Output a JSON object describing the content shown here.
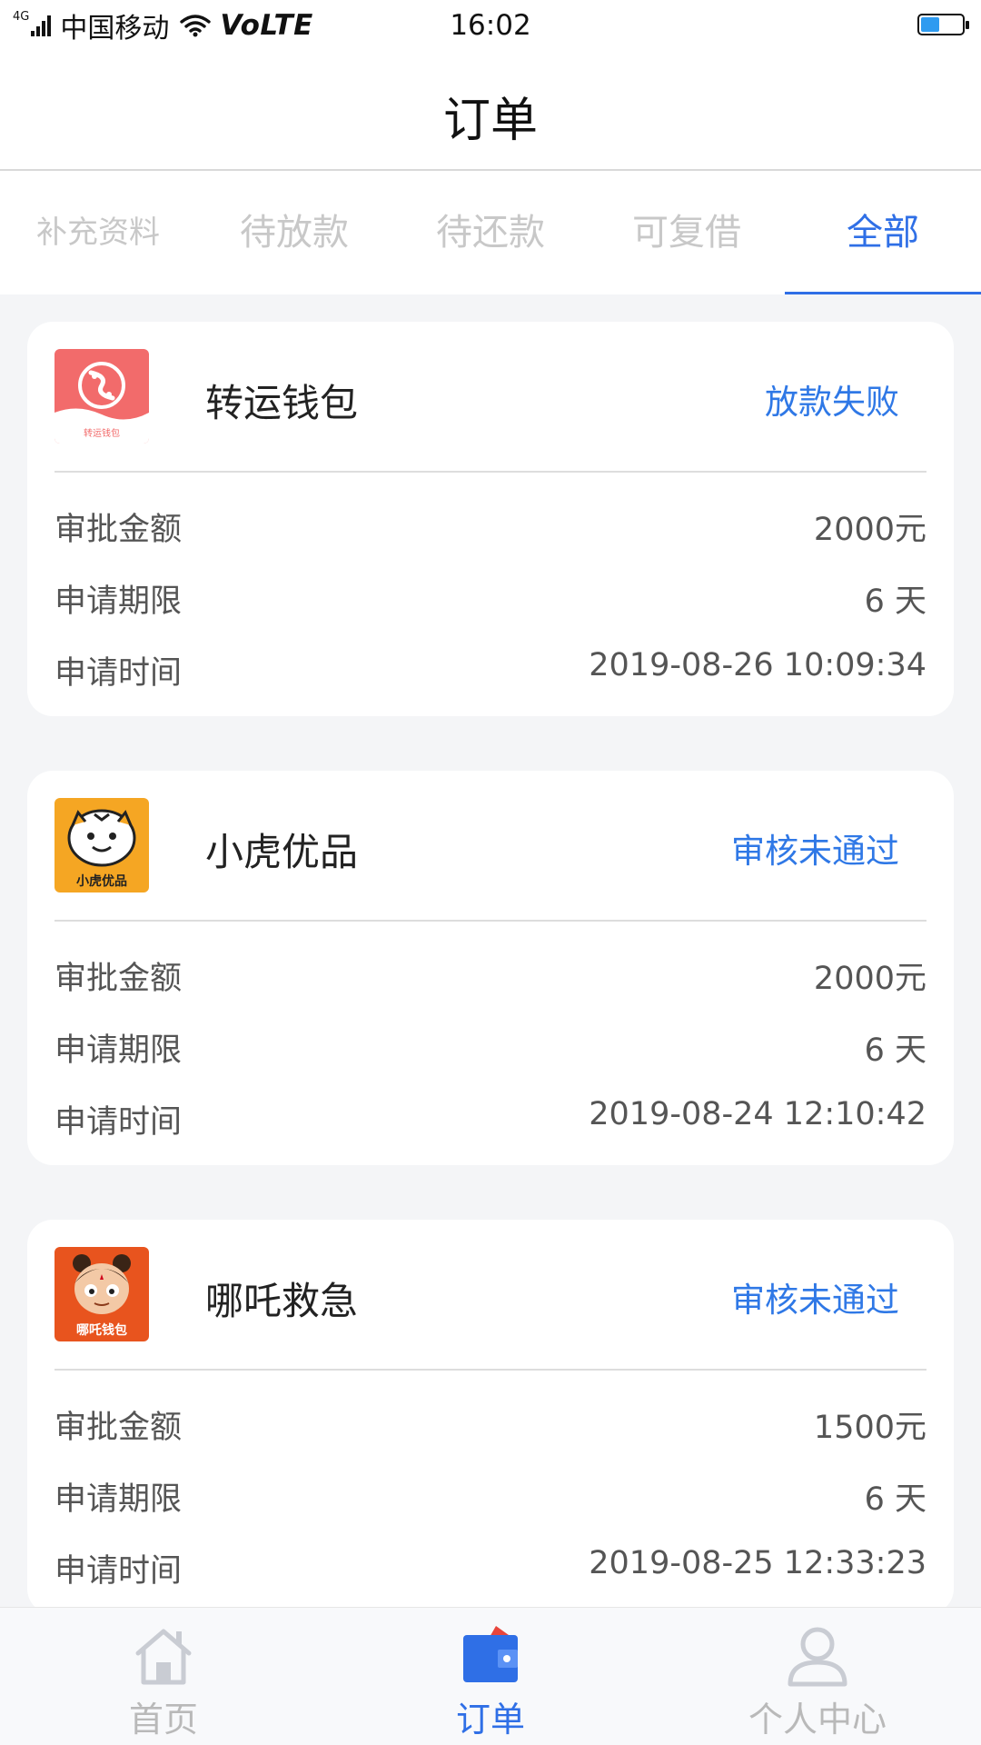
{
  "status_bar": {
    "network": "4G",
    "carrier": "中国移动",
    "volte": "VoLTE",
    "time": "16:02"
  },
  "header": {
    "title": "订单"
  },
  "tabs": [
    {
      "label": "补充资料",
      "active": false
    },
    {
      "label": "待放款",
      "active": false
    },
    {
      "label": "待还款",
      "active": false
    },
    {
      "label": "可复借",
      "active": false
    },
    {
      "label": "全部",
      "active": true
    }
  ],
  "orders": [
    {
      "app_name": "转运钱包",
      "logo_text": "转运钱包",
      "status": "放款失败",
      "amount_label": "审批金额",
      "amount": "2000元",
      "term_label": "申请期限",
      "term": "6 天",
      "time_label": "申请时间",
      "time": "2019-08-26 10:09:34"
    },
    {
      "app_name": "小虎优品",
      "logo_text": "小虎优品",
      "status": "审核未通过",
      "amount_label": "审批金额",
      "amount": "2000元",
      "term_label": "申请期限",
      "term": "6 天",
      "time_label": "申请时间",
      "time": "2019-08-24 12:10:42"
    },
    {
      "app_name": "哪吒救急",
      "logo_text": "哪吒钱包",
      "status": "审核未通过",
      "amount_label": "审批金额",
      "amount": "1500元",
      "term_label": "申请期限",
      "term": "6 天",
      "time_label": "申请时间",
      "time": "2019-08-25 12:33:23"
    }
  ],
  "bottom_nav": [
    {
      "label": "首页",
      "icon": "home-icon",
      "active": false
    },
    {
      "label": "订单",
      "icon": "wallet-icon",
      "active": true
    },
    {
      "label": "个人中心",
      "icon": "user-icon",
      "active": false
    }
  ],
  "colors": {
    "accent": "#2f6fe6",
    "status_text": "#2f78e6",
    "tab_inactive": "#c8c8c8",
    "background": "#f4f5f7"
  }
}
